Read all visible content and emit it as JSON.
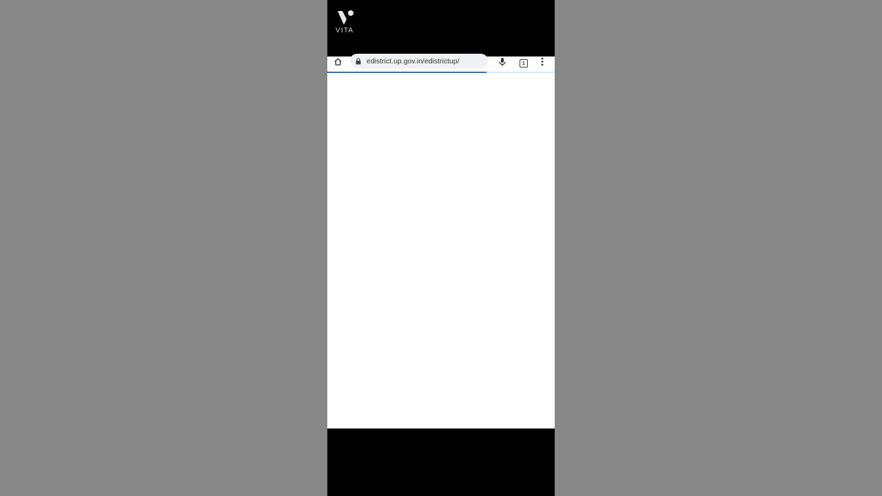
{
  "watermark": {
    "brand": "VITA"
  },
  "browser": {
    "url": "edistrict.up.gov.in/edistrictup/",
    "tab_count": "1",
    "load_progress": 0.7,
    "icons": {
      "home": "home-icon",
      "lock": "lock-icon",
      "mic": "microphone-icon",
      "tabs": "tabs-icon",
      "menu": "more-vert-icon"
    }
  },
  "colors": {
    "backdrop": "#878787",
    "progress": "#3b6fa7"
  }
}
